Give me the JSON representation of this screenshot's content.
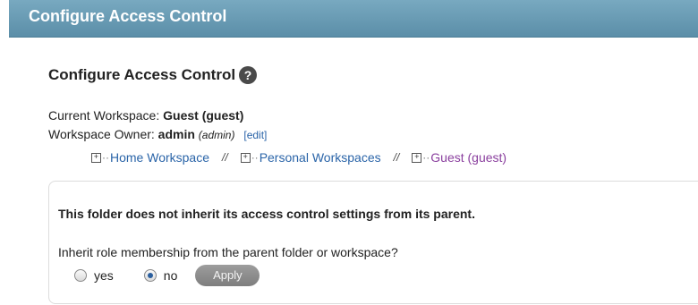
{
  "title_bar": {
    "title": "Configure Access Control"
  },
  "heading": {
    "title": "Configure Access Control",
    "help_icon": "help-icon"
  },
  "workspace": {
    "current_label": "Current Workspace:",
    "current_value": "Guest (guest)",
    "owner_label": "Workspace Owner:",
    "owner_name": "admin",
    "owner_id": "(admin)",
    "edit_label": "[edit]"
  },
  "breadcrumb": {
    "items": [
      {
        "label": "Home Workspace"
      },
      {
        "label": "Personal Workspaces"
      },
      {
        "label": "Guest (guest)"
      }
    ],
    "separator": "//"
  },
  "panel": {
    "note": "This folder does not inherit its access control settings from its parent.",
    "question": "Inherit role membership from the parent folder or workspace?",
    "options": [
      "yes",
      "no"
    ],
    "selected": "no",
    "apply_label": "Apply"
  }
}
